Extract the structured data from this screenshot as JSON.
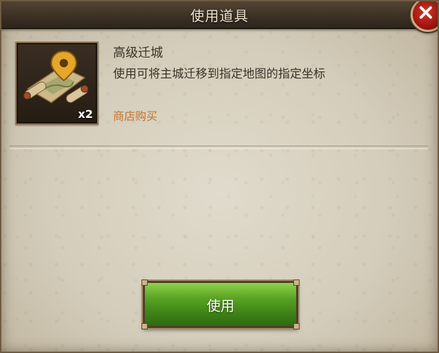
{
  "dialog": {
    "title": "使用道具",
    "close_icon": "close-x-icon"
  },
  "item": {
    "icon": "relocation-map-scroll-icon",
    "count": "x2",
    "name": "高级迁城",
    "description": "使用可将主城迁移到指定地图的指定坐标",
    "shop_link": "商店购买"
  },
  "actions": {
    "use_label": "使用"
  },
  "colors": {
    "title_bar": "#3e3226",
    "panel": "#d4cdbb",
    "link_orange": "#c4742a",
    "button_green": "#4f9a1e",
    "close_red": "#a4160f"
  }
}
